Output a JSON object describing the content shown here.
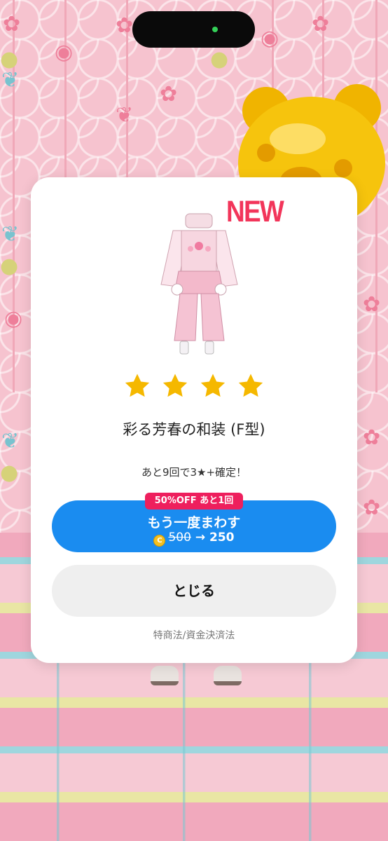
{
  "modal": {
    "new_badge": "NEW",
    "rating_stars": 4,
    "item_name": "彩る芳春の和装 (F型)",
    "guarantee_text": "あと9回で3★+確定！",
    "spin_again": {
      "discount_badge": "50%OFF あと1回",
      "label": "もう一度まわす",
      "currency_icon": "coin-icon",
      "old_price": "500",
      "arrow": "→",
      "new_price": "250"
    },
    "close_label": "とじる",
    "legal_link": "特商法/資金決済法"
  },
  "colors": {
    "primary_button": "#1a8cf0",
    "discount_badge": "#ee1f5d",
    "new_badge": "#f2355a",
    "star": "#f5b800"
  }
}
